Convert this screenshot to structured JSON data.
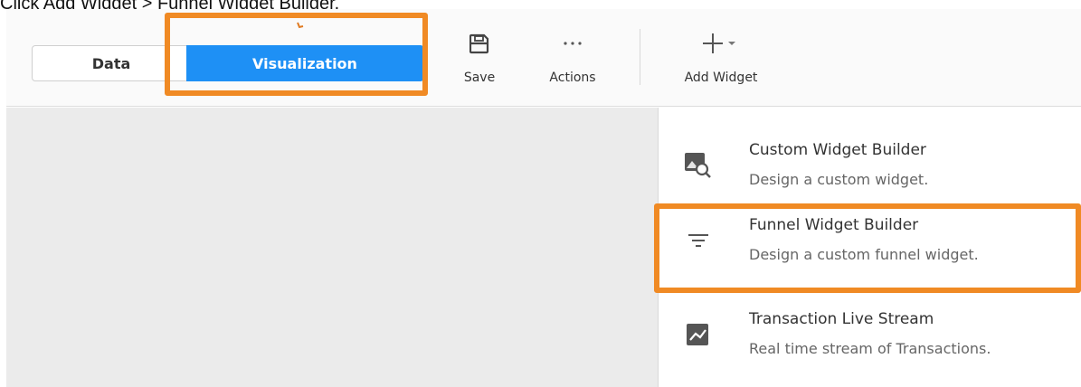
{
  "caption": "Click Add Widget > Funnel Widget Builder.",
  "toolbar": {
    "tabs": [
      {
        "label": "Data",
        "active": false
      },
      {
        "label": "Visualization",
        "active": true
      }
    ],
    "save_label": "Save",
    "save_icon": "save-icon",
    "actions_label": "Actions",
    "actions_icon": "ellipsis-icon",
    "add_widget_label": "Add Widget",
    "add_widget_icon": "plus-dropdown-icon"
  },
  "menu": {
    "items": [
      {
        "title": "Custom Widget Builder",
        "description": "Design a custom widget.",
        "icon": "image-search-icon"
      },
      {
        "title": "Funnel Widget Builder",
        "description": "Design a custom funnel widget.",
        "icon": "funnel-icon"
      },
      {
        "title": "Transaction Live Stream",
        "description": "Real time stream of Transactions.",
        "icon": "line-chart-icon"
      }
    ]
  },
  "colors": {
    "accent": "#1e90f5",
    "highlight": "#f08a24",
    "canvas": "#ebebeb"
  }
}
